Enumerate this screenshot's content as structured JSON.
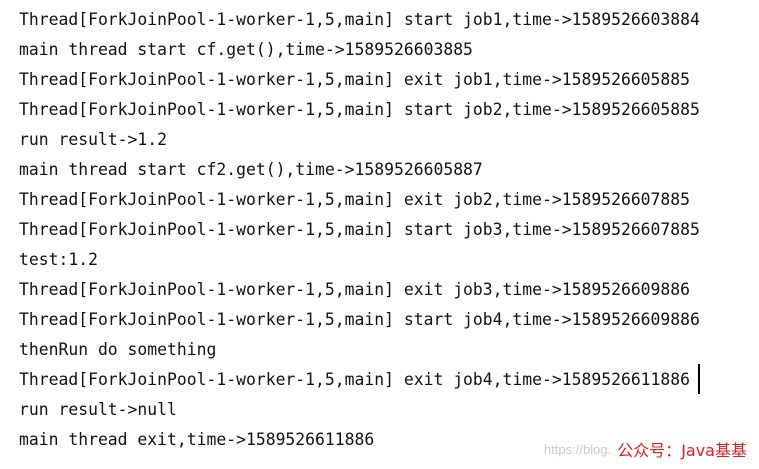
{
  "console": {
    "lines": [
      "Thread[ForkJoinPool-1-worker-1,5,main] start job1,time->1589526603884",
      "main thread start cf.get(),time->1589526603885",
      "Thread[ForkJoinPool-1-worker-1,5,main] exit job1,time->1589526605885",
      "Thread[ForkJoinPool-1-worker-1,5,main] start job2,time->1589526605885",
      "run result->1.2",
      "main thread start cf2.get(),time->1589526605887",
      "Thread[ForkJoinPool-1-worker-1,5,main] exit job2,time->1589526607885",
      "Thread[ForkJoinPool-1-worker-1,5,main] start job3,time->1589526607885",
      "test:1.2",
      "Thread[ForkJoinPool-1-worker-1,5,main] exit job3,time->1589526609886",
      "Thread[ForkJoinPool-1-worker-1,5,main] start job4,time->1589526609886",
      "thenRun do something",
      "Thread[ForkJoinPool-1-worker-1,5,main] exit job4,time->1589526611886",
      "run result->null",
      "main thread exit,time->1589526611886"
    ]
  },
  "watermark": {
    "url": "https://blog.",
    "brand": "公众号：Java基基"
  },
  "colors": {
    "text": "#111111",
    "background": "#ffffff",
    "watermark_brand": "#e02020",
    "watermark_url": "#c9c9c9"
  }
}
